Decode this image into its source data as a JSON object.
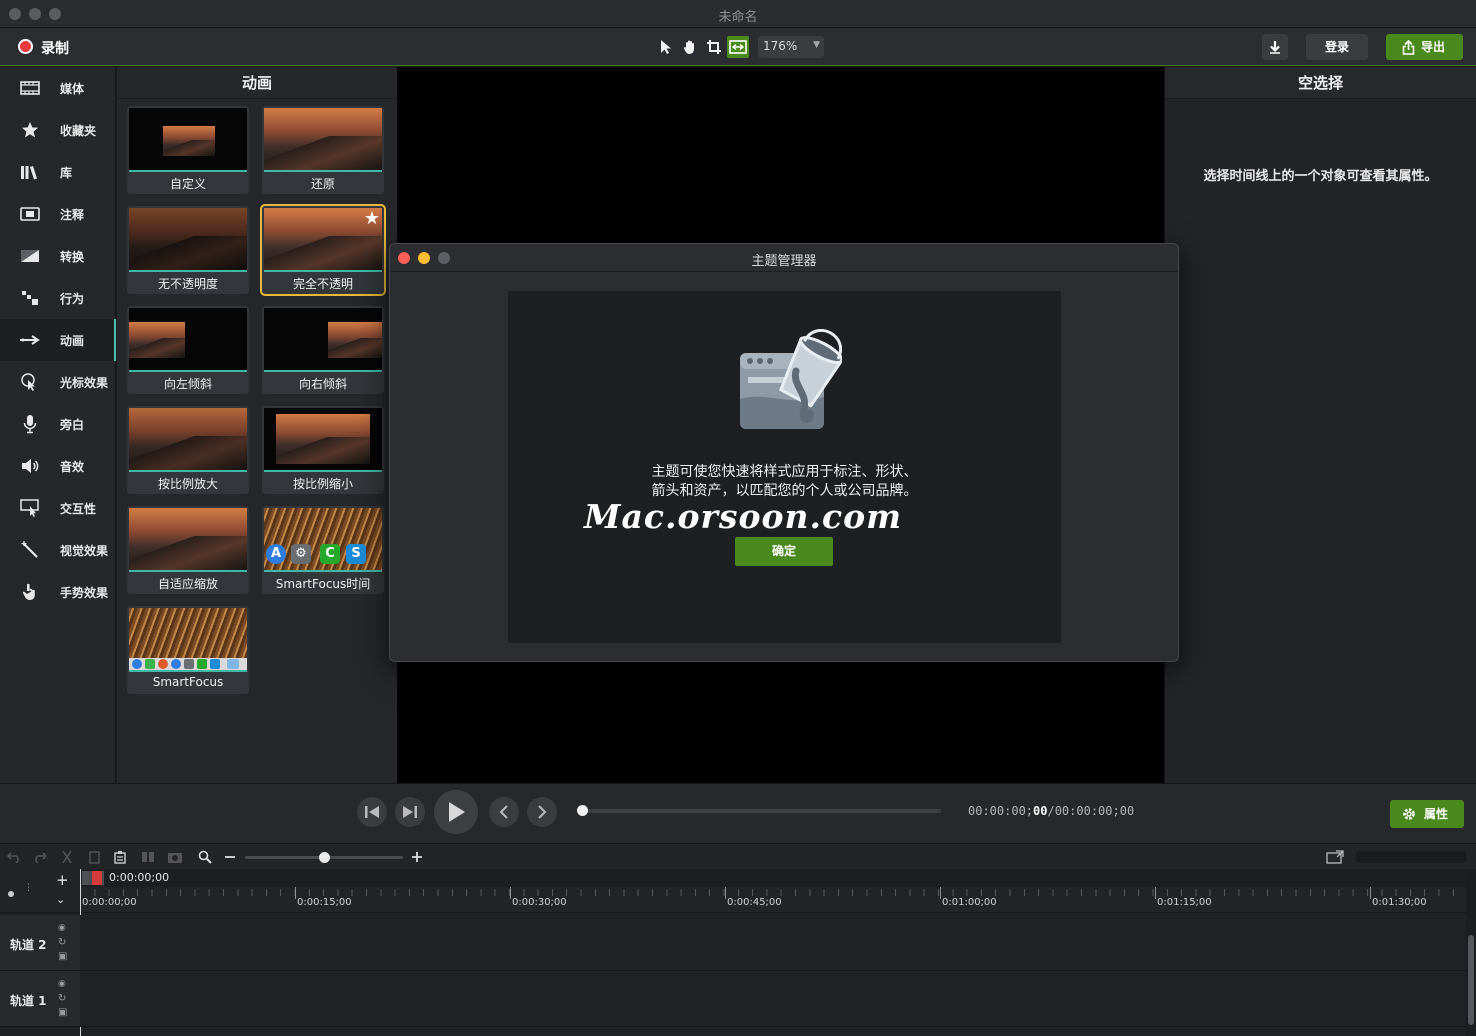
{
  "window": {
    "title": "未命名"
  },
  "toolbar": {
    "record_label": "录制",
    "tools": [
      "pointer-icon",
      "hand-icon",
      "crop-icon",
      "fit-icon"
    ],
    "zoom_value": "176%",
    "login_label": "登录",
    "export_label": "导出"
  },
  "sidebar": {
    "items": [
      {
        "label": "媒体",
        "icon": "film-icon"
      },
      {
        "label": "收藏夹",
        "icon": "star-icon"
      },
      {
        "label": "库",
        "icon": "library-icon"
      },
      {
        "label": "注释",
        "icon": "annotation-icon"
      },
      {
        "label": "转换",
        "icon": "transition-icon"
      },
      {
        "label": "行为",
        "icon": "behavior-icon"
      },
      {
        "label": "动画",
        "icon": "animation-icon",
        "active": true
      },
      {
        "label": "光标效果",
        "icon": "cursor-icon"
      },
      {
        "label": "旁白",
        "icon": "microphone-icon"
      },
      {
        "label": "音效",
        "icon": "speaker-icon"
      },
      {
        "label": "交互性",
        "icon": "interactive-icon"
      },
      {
        "label": "视觉效果",
        "icon": "wand-icon"
      },
      {
        "label": "手势效果",
        "icon": "gesture-icon"
      }
    ]
  },
  "animations": {
    "title": "动画",
    "tiles": [
      {
        "label": "自定义"
      },
      {
        "label": "还原"
      },
      {
        "label": "无不透明度"
      },
      {
        "label": "完全不透明",
        "selected": true
      },
      {
        "label": "向左倾斜"
      },
      {
        "label": "向右倾斜"
      },
      {
        "label": "按比例放大"
      },
      {
        "label": "按比例缩小"
      },
      {
        "label": "自适应缩放"
      },
      {
        "label": "SmartFocus时间"
      },
      {
        "label": "SmartFocus"
      }
    ]
  },
  "properties": {
    "title": "空选择",
    "message": "选择时间线上的一个对象可查看其属性。",
    "button_label": "属性"
  },
  "dialog": {
    "title": "主题管理器",
    "message_line1": "主题可使您快速将样式应用于标注、形状、",
    "message_line2": "箭头和资产，以匹配您的个人或公司品牌。",
    "watermark": "Mac.orsoon.com",
    "ok_label": "确定",
    "icon": "paint-bucket-icon"
  },
  "playback": {
    "time_current": "00:00:00;",
    "time_current_frames": "00",
    "time_total": "/00:00:00;00",
    "progress": 0
  },
  "timeline": {
    "playhead_time": "0:00:00;00",
    "zoom_level": 0.5,
    "ruler_marks": [
      "0:00:00;00",
      "0:00:15;00",
      "0:00:30;00",
      "0:00:45;00",
      "0:01:00;00",
      "0:01:15;00",
      "0:01:30;00"
    ],
    "tracks": [
      "轨道 2",
      "轨道 1"
    ]
  },
  "colors": {
    "accent_green": "#4a8a1c",
    "record_red": "#e8393e",
    "selection_gold": "#e9b93b",
    "tile_bar_teal": "#3fb9a6"
  }
}
